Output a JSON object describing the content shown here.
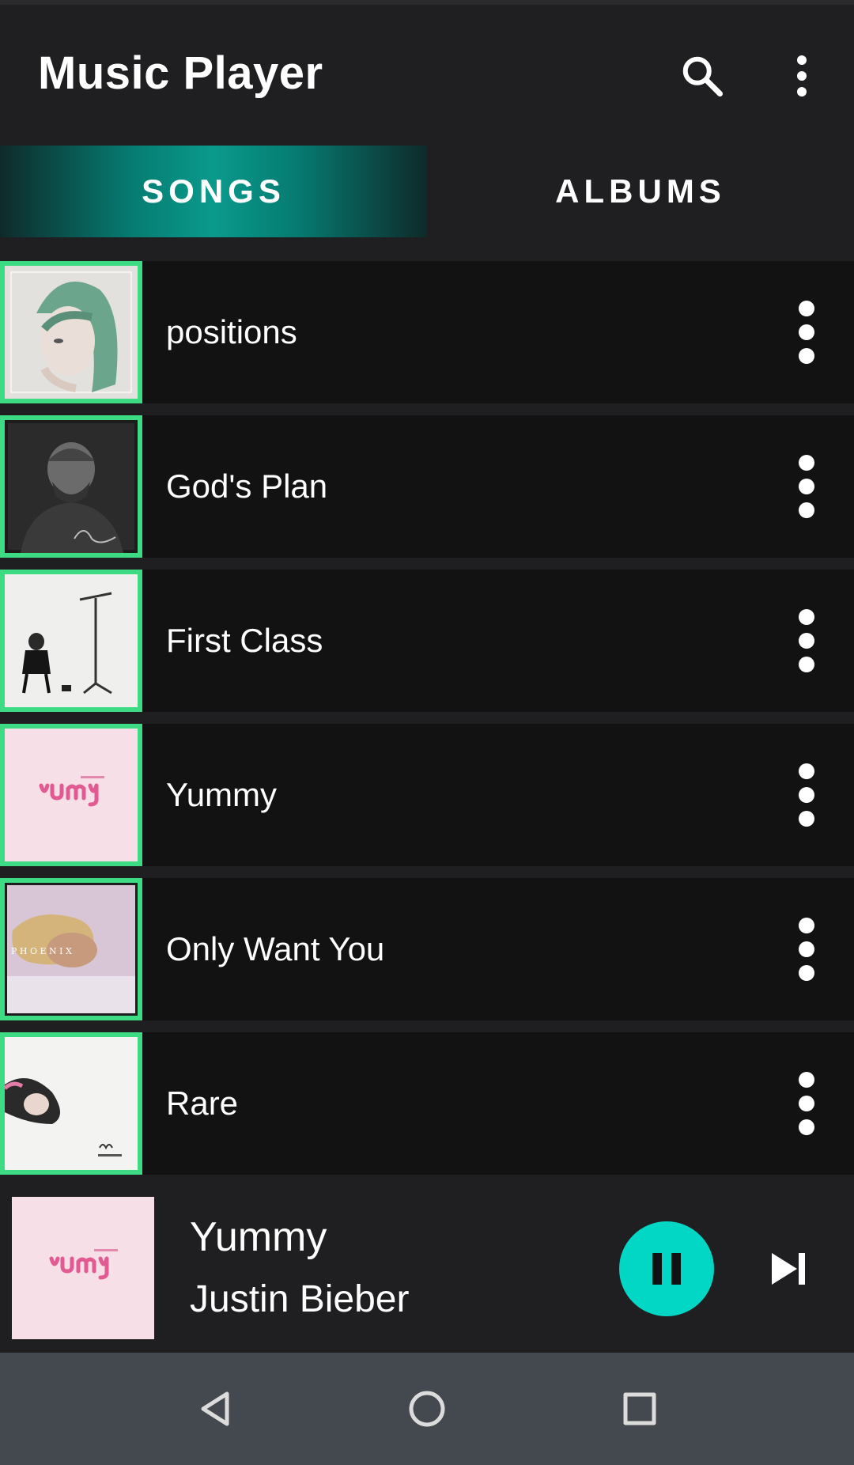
{
  "app": {
    "title": "Music Player"
  },
  "toolbar": {
    "search_icon": "search-icon",
    "menu_icon": "more-vertical-icon"
  },
  "tabs": [
    {
      "label": "SONGS",
      "selected": true
    },
    {
      "label": "ALBUMS",
      "selected": false
    }
  ],
  "songs": [
    {
      "title": "positions",
      "art": "positions-album-art"
    },
    {
      "title": "God's Plan",
      "art": "scorpion-album-art"
    },
    {
      "title": "First Class",
      "art": "first-class-album-art"
    },
    {
      "title": "Yummy",
      "art": "yummy-album-art"
    },
    {
      "title": "Only Want You",
      "art": "phoenix-album-art"
    },
    {
      "title": "Rare",
      "art": "rare-album-art"
    }
  ],
  "now_playing": {
    "title": "Yummy",
    "artist": "Justin Bieber",
    "state": "playing",
    "pause_icon": "pause-icon",
    "next_icon": "skip-next-icon"
  },
  "colors": {
    "accent": "#02d6c4",
    "tab_highlight": "#0a9a8c",
    "art_border": "#3ddc84",
    "background": "#1f1f21",
    "row_background": "#121212",
    "nav_bar": "#43494f"
  },
  "nav": {
    "back_icon": "back-icon",
    "home_icon": "home-icon",
    "recents_icon": "recents-icon"
  }
}
